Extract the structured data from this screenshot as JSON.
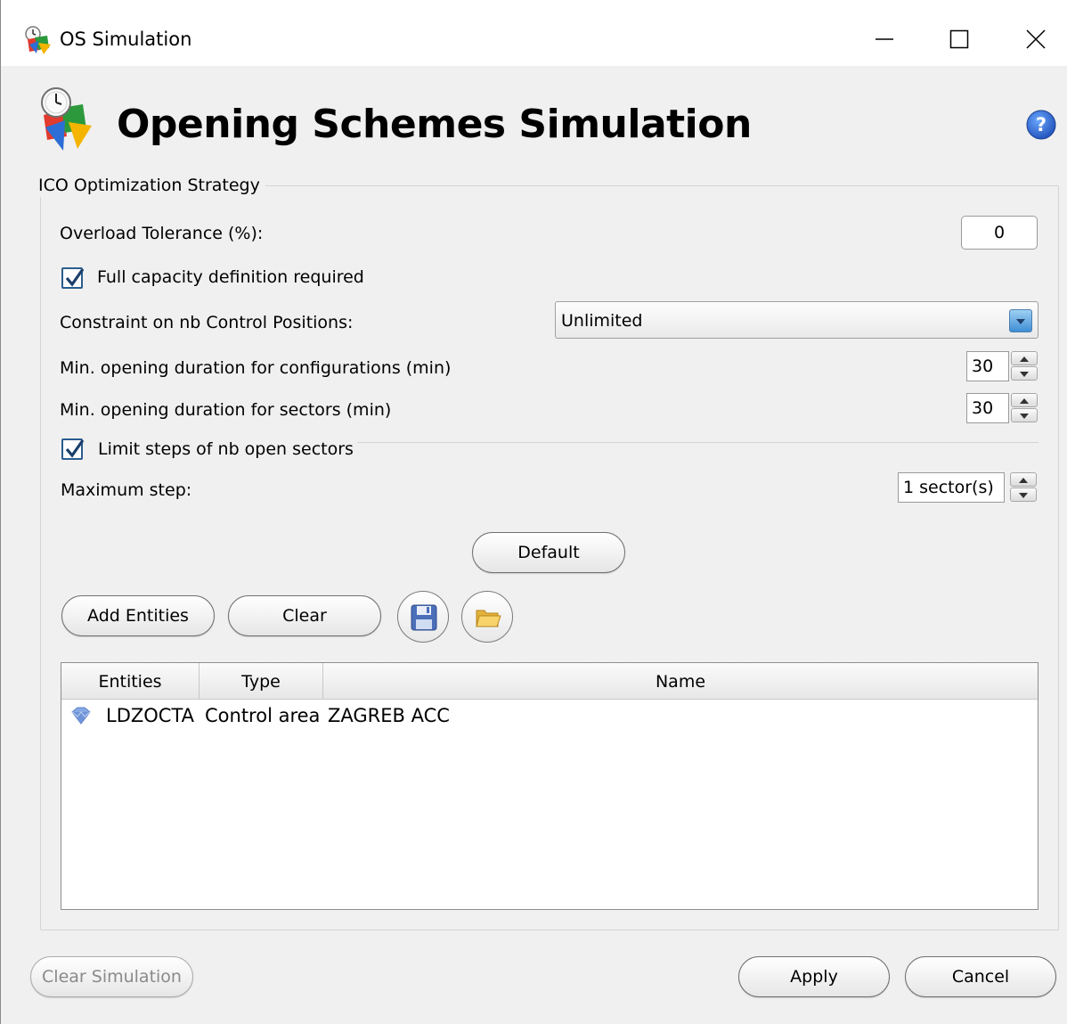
{
  "window": {
    "title": "OS Simulation",
    "controls": {
      "minimize": "—",
      "maximize": "☐",
      "close": "✕"
    }
  },
  "header": {
    "title": "Opening Schemes Simulation"
  },
  "group": {
    "title": "ICO Optimization Strategy",
    "overload_label": "Overload Tolerance (%):",
    "overload_value": "0",
    "full_capacity_label": "Full capacity definition required",
    "full_capacity_checked": true,
    "constraint_label": "Constraint on nb Control Positions:",
    "constraint_value": "Unlimited",
    "min_config_label": "Min. opening duration for configurations (min)",
    "min_config_value": "30",
    "min_sectors_label": "Min. opening duration for sectors (min)",
    "min_sectors_value": "30",
    "limit_steps_label": "Limit steps of nb open sectors",
    "limit_steps_checked": true,
    "max_step_label": "Maximum step:",
    "max_step_value": "1 sector(s)",
    "default_button": "Default",
    "add_entities_button": "Add Entities",
    "clear_button": "Clear",
    "table": {
      "columns": [
        "Entities",
        "Type",
        "Name"
      ],
      "rows": [
        {
          "entity": "LDZOCTA",
          "type": "Control area",
          "name": "ZAGREB ACC",
          "icon": "control-area-icon"
        }
      ]
    }
  },
  "footer": {
    "clear_simulation_button": "Clear Simulation",
    "apply_button": "Apply",
    "cancel_button": "Cancel"
  },
  "colors": {
    "accent": "#2a5d8f",
    "background": "#f0f0f0"
  }
}
